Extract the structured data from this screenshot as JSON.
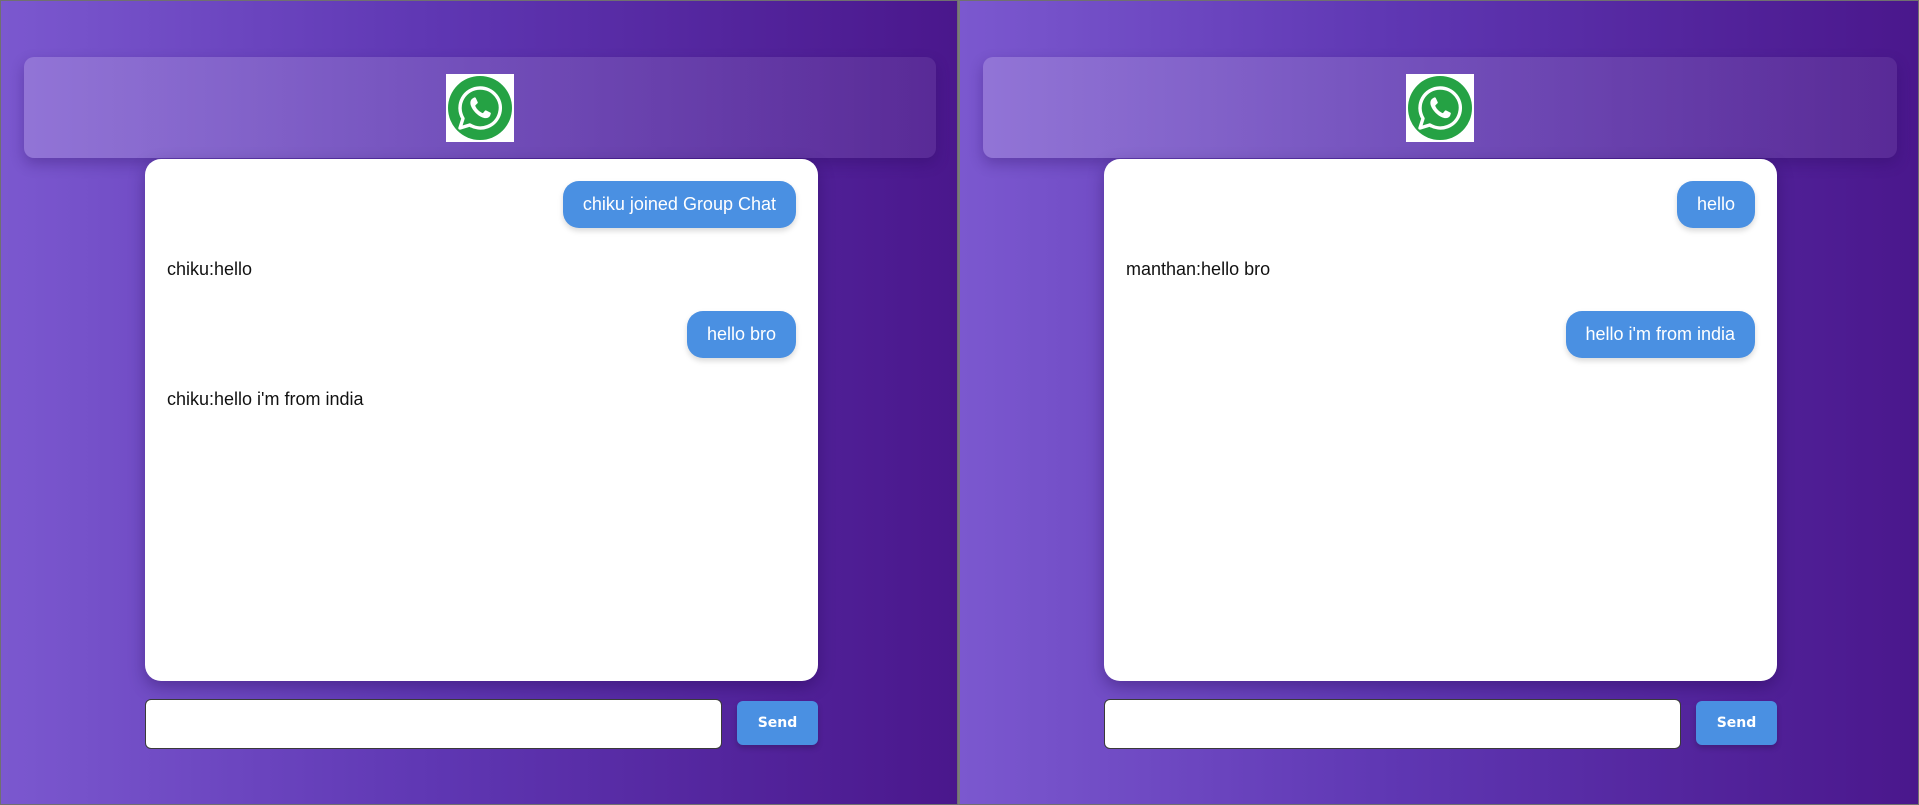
{
  "app": {
    "logo_icon": "whatsapp-icon",
    "brand_color": "#25a244",
    "accent": "#4a90e2"
  },
  "panes": [
    {
      "messages": [
        {
          "type": "out",
          "text": "chiku joined Group Chat"
        },
        {
          "type": "in",
          "text": "chiku:hello"
        },
        {
          "type": "out",
          "text": "hello bro"
        },
        {
          "type": "in",
          "text": "chiku:hello i'm from india"
        }
      ],
      "input_value": "",
      "send_label": "Send"
    },
    {
      "messages": [
        {
          "type": "out",
          "text": "hello"
        },
        {
          "type": "in",
          "text": "manthan:hello bro"
        },
        {
          "type": "out",
          "text": "hello i'm from india"
        }
      ],
      "input_value": "",
      "send_label": "Send"
    }
  ]
}
